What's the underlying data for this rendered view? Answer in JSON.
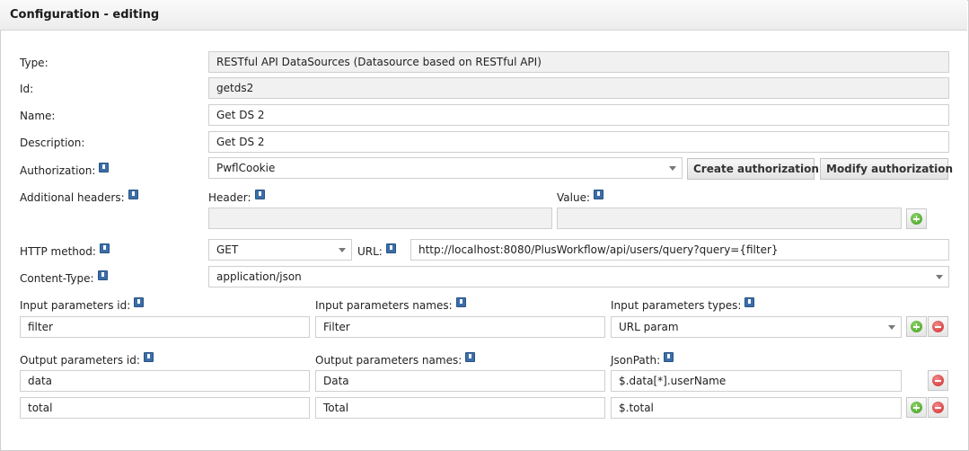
{
  "header": {
    "title": "Configuration - editing"
  },
  "labels": {
    "type": "Type:",
    "id": "Id:",
    "name": "Name:",
    "description": "Description:",
    "authorization": "Authorization:",
    "additional_headers": "Additional headers:",
    "header": "Header:",
    "value": "Value:",
    "http_method": "HTTP method:",
    "url": "URL:",
    "content_type": "Content-Type:",
    "input_params_id": "Input parameters id:",
    "input_params_names": "Input parameters names:",
    "input_params_types": "Input parameters types:",
    "output_params_id": "Output parameters id:",
    "output_params_names": "Output parameters names:",
    "json_path": "JsonPath:"
  },
  "fields": {
    "type": "RESTful API DataSources (Datasource based on RESTful API)",
    "id": "getds2",
    "name": "Get DS 2",
    "description": "Get DS 2",
    "authorization": "PwflCookie",
    "header_value": "",
    "value_value": "",
    "http_method": "GET",
    "url": "http://localhost:8080/PlusWorkflow/api/users/query?query={filter}",
    "content_type": "application/json"
  },
  "buttons": {
    "create_authorization": "Create authorization",
    "modify_authorization": "Modify authorization"
  },
  "input_params": [
    {
      "id": "filter",
      "name": "Filter",
      "type": "URL param"
    }
  ],
  "output_params": [
    {
      "id": "data",
      "name": "Data",
      "json_path": "$.data[*].userName"
    },
    {
      "id": "total",
      "name": "Total",
      "json_path": "$.total"
    }
  ],
  "icons": {
    "info": "info-icon",
    "add": "add-icon",
    "remove": "remove-icon",
    "dropdown": "chevron-down-icon"
  },
  "colors": {
    "add": "#3f9a1f",
    "remove": "#cc2a2a",
    "info": "#3b6ea8",
    "readonly_bg": "#f1f1f1"
  }
}
